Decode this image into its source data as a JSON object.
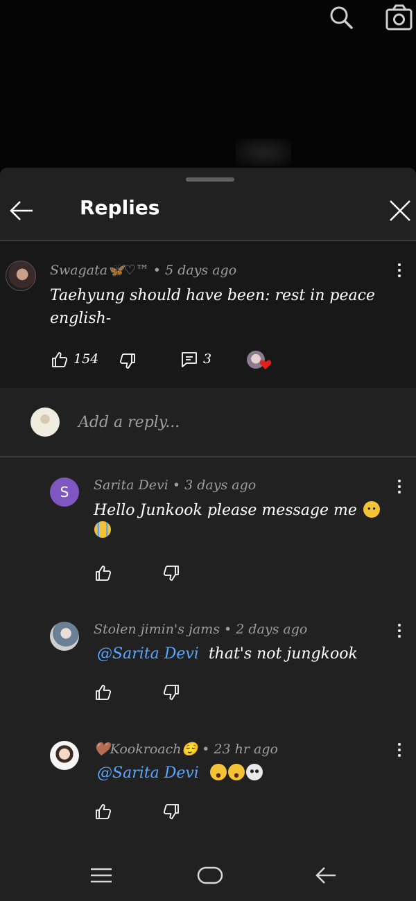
{
  "header": {
    "title": "Replies"
  },
  "parent_comment": {
    "author": "Swagata🦋♡™",
    "time": "5 days ago",
    "text_line1": "Taehyung should have been: rest in peace",
    "text_line2": "english-",
    "likes": "154",
    "replies_count": "3"
  },
  "reply_input": {
    "placeholder": "Add a reply..."
  },
  "replies": [
    {
      "author": "Sarita Devi",
      "time": "3 days ago",
      "avatar_letter": "S",
      "avatar_color": "#7e57c2",
      "text": "Hello Junkook please message me"
    },
    {
      "author": "Stolen jimin's jams",
      "time": "2 days ago",
      "mention": "@Sarita Devi",
      "text": "that's not jungkook"
    },
    {
      "author": "🤎Kookroach😌",
      "time": "23 hr ago",
      "mention": "@Sarita Devi"
    }
  ],
  "colors": {
    "sheet_bg": "#212121",
    "parent_bg": "#181818",
    "mention": "#5aa5ff",
    "meta": "#9e9e9e"
  },
  "icons": [
    "search-icon",
    "camera-icon",
    "back-arrow-icon",
    "close-icon",
    "like-icon",
    "dislike-icon",
    "reply-icon",
    "menu-icon",
    "home-icon",
    "nav-back-icon"
  ]
}
